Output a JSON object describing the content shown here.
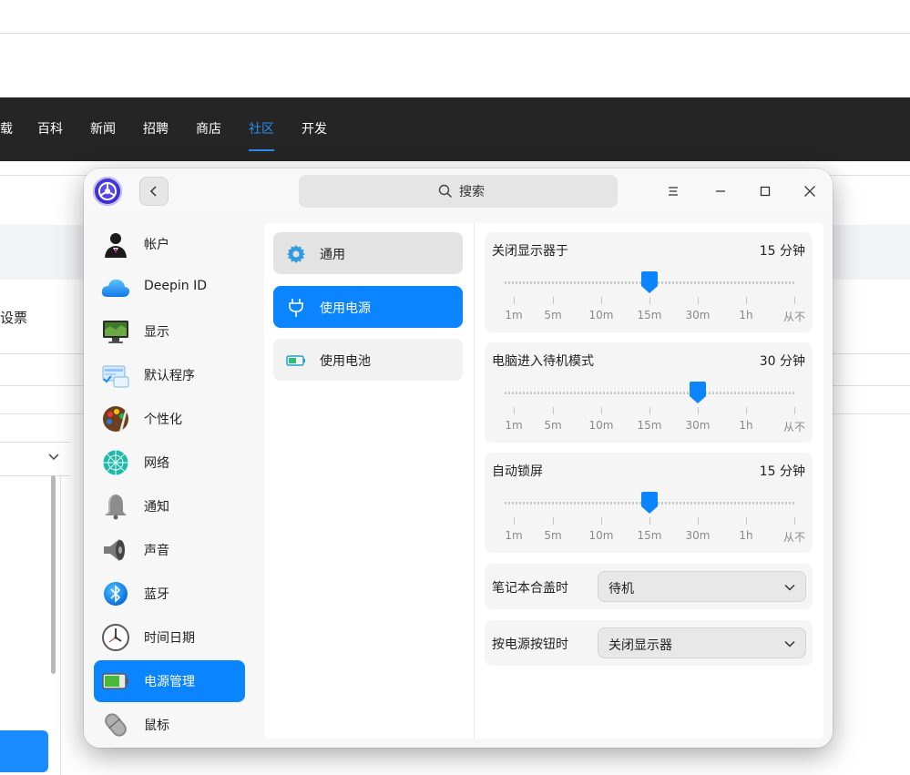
{
  "background_site": {
    "nav_items": [
      "载",
      "百科",
      "新闻",
      "招聘",
      "商店",
      "社区",
      "开发"
    ],
    "active_nav": "社区",
    "partial_text": "设票"
  },
  "window": {
    "search_placeholder": "搜索"
  },
  "sidebar": {
    "items": [
      {
        "label": "帐户",
        "icon": "account-icon"
      },
      {
        "label": "Deepin ID",
        "icon": "cloud-icon"
      },
      {
        "label": "显示",
        "icon": "display-icon"
      },
      {
        "label": "默认程序",
        "icon": "default-apps-icon"
      },
      {
        "label": "个性化",
        "icon": "palette-icon"
      },
      {
        "label": "网络",
        "icon": "network-icon"
      },
      {
        "label": "通知",
        "icon": "bell-icon"
      },
      {
        "label": "声音",
        "icon": "speaker-icon"
      },
      {
        "label": "蓝牙",
        "icon": "bluetooth-icon"
      },
      {
        "label": "时间日期",
        "icon": "clock-icon"
      },
      {
        "label": "电源管理",
        "icon": "battery-icon"
      },
      {
        "label": "鼠标",
        "icon": "mouse-icon"
      }
    ],
    "active": "电源管理"
  },
  "power_menu": {
    "items": [
      {
        "label": "通用",
        "icon": "gear-icon"
      },
      {
        "label": "使用电源",
        "icon": "plug-icon"
      },
      {
        "label": "使用电池",
        "icon": "battery-small-icon"
      }
    ],
    "active": "使用电源"
  },
  "sliders": [
    {
      "title": "关闭显示器于",
      "value": "15 分钟",
      "position_index": 3
    },
    {
      "title": "电脑进入待机模式",
      "value": "30 分钟",
      "position_index": 4
    },
    {
      "title": "自动锁屏",
      "value": "15 分钟",
      "position_index": 3
    }
  ],
  "slider_ticks": [
    "1m",
    "5m",
    "10m",
    "15m",
    "30m",
    "1h",
    "从不"
  ],
  "lid_close": {
    "label": "笔记本合盖时",
    "value": "待机"
  },
  "power_button": {
    "label": "按电源按钮时",
    "value": "关闭显示器"
  },
  "colors": {
    "accent": "#0a84ff",
    "nav_bg": "#252525",
    "nav_active": "#2d8cf0"
  }
}
